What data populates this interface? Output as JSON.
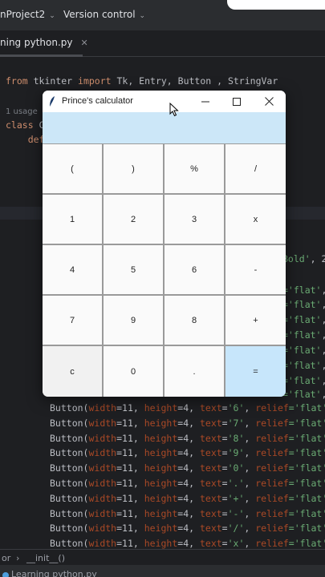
{
  "ide": {
    "project_label": "nProject2",
    "vcs_label": "Version control",
    "file_tab": "ning python.py",
    "tab_close": "✕",
    "code_lines": [
      {
        "id": "import",
        "parts": [
          [
            "kw",
            "from"
          ],
          [
            "t",
            " tkinter "
          ],
          [
            "kw",
            "import"
          ],
          [
            "t",
            " Tk, Entry, Button , StringVar"
          ]
        ]
      },
      {
        "id": "usage",
        "parts": [
          [
            "hint",
            "1 usage"
          ]
        ]
      },
      {
        "id": "class",
        "parts": [
          [
            "kw",
            "class"
          ],
          [
            "t",
            " C"
          ]
        ]
      },
      {
        "id": "def",
        "parts": [
          [
            "t",
            "    "
          ],
          [
            "kw",
            "def"
          ]
        ]
      },
      {
        "id": "bold",
        "parts": [
          [
            "str",
            "Bold'"
          ],
          [
            "t",
            ", 2"
          ]
        ]
      },
      {
        "id": "flat1",
        "parts": [
          [
            "str",
            "='flat'"
          ],
          [
            "t",
            ","
          ]
        ]
      },
      {
        "id": "flat2",
        "parts": [
          [
            "str",
            "='flat'"
          ],
          [
            "t",
            ","
          ]
        ]
      },
      {
        "id": "flat3",
        "parts": [
          [
            "str",
            "='flat'"
          ],
          [
            "t",
            ","
          ]
        ]
      },
      {
        "id": "flat4",
        "parts": [
          [
            "str",
            "='flat'"
          ],
          [
            "t",
            ","
          ]
        ]
      },
      {
        "id": "flat5",
        "parts": [
          [
            "str",
            "='flat'"
          ],
          [
            "t",
            ","
          ]
        ]
      },
      {
        "id": "flat6",
        "parts": [
          [
            "str",
            "='flat'"
          ],
          [
            "t",
            ","
          ]
        ]
      },
      {
        "id": "flat7",
        "parts": [
          [
            "str",
            "='flat'"
          ],
          [
            "t",
            ","
          ]
        ]
      },
      {
        "id": "flat8",
        "parts": [
          [
            "str",
            "='flat'"
          ],
          [
            "t",
            ","
          ]
        ]
      },
      {
        "id": "b6",
        "button": "6"
      },
      {
        "id": "b7",
        "button": "7"
      },
      {
        "id": "b8",
        "button": "8"
      },
      {
        "id": "b9",
        "button": "9"
      },
      {
        "id": "b0",
        "button": "0"
      },
      {
        "id": "bdot",
        "button": "."
      },
      {
        "id": "bplus",
        "button": "+"
      },
      {
        "id": "bminus",
        "button": "-"
      },
      {
        "id": "bslash",
        "button": "/"
      },
      {
        "id": "bx",
        "button": "x"
      }
    ],
    "button_template": {
      "call": "Button(",
      "width_kw": "width",
      "width_val": "=11, ",
      "height_kw": "height",
      "height_val": "=4, ",
      "text_kw": "text",
      "relief_kw": "relief",
      "relief_val": "='flat',"
    },
    "status_left": "or",
    "status_arrow": "›",
    "status_func": "__init__()",
    "bottom_file": "Learning python.py"
  },
  "calculator": {
    "title": "Prince's calculator",
    "entry_value": "",
    "rows": [
      [
        "(",
        ")",
        "%",
        "/"
      ],
      [
        "1",
        "2",
        "3",
        "x"
      ],
      [
        "4",
        "5",
        "6",
        "-"
      ],
      [
        "7",
        "9",
        "8",
        "+"
      ],
      [
        "c",
        "0",
        ".",
        "="
      ]
    ]
  },
  "colors": {
    "entry_bg": "#cce7f8",
    "equals_bg": "#c7e6fb",
    "ide_bg": "#1e1f22",
    "keyword": "#cf8e6d",
    "string": "#6aab73",
    "param": "#aa4926"
  },
  "icons": {
    "window_app": "feather-icon",
    "minimize": "minimize-icon",
    "maximize": "maximize-icon",
    "close": "close-icon",
    "pointer": "mouse-cursor-icon"
  }
}
